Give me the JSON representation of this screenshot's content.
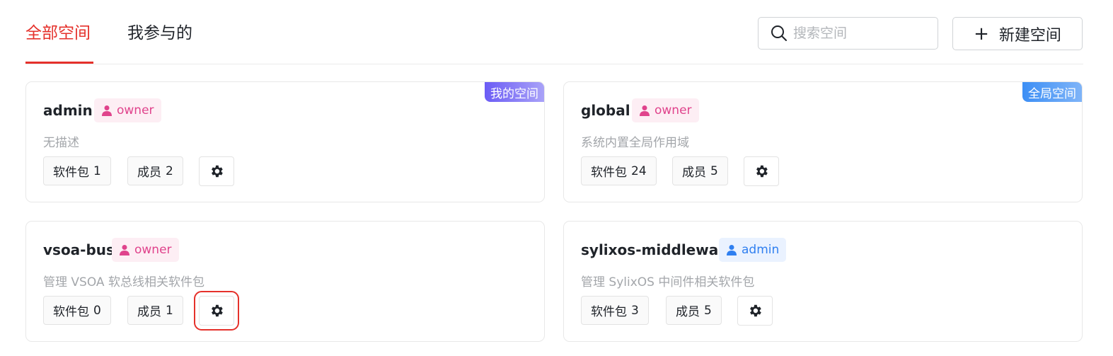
{
  "tabs": [
    {
      "label": "全部空间",
      "active": true
    },
    {
      "label": "我参与的",
      "active": false
    }
  ],
  "search": {
    "placeholder": "搜索空间",
    "value": ""
  },
  "new_button": {
    "label": "新建空间"
  },
  "colors": {
    "accent": "#e5312b",
    "owner": "#e0438c",
    "admin": "#2f7ff0"
  },
  "cards": [
    {
      "name": "admin",
      "role": "owner",
      "badge": "我的空间",
      "description": "无描述",
      "packages_label": "软件包",
      "packages": "1",
      "members_label": "成员",
      "members": "2"
    },
    {
      "name": "global",
      "role": "owner",
      "badge": "全局空间",
      "description": "系统内置全局作用域",
      "packages_label": "软件包",
      "packages": "24",
      "members_label": "成员",
      "members": "5"
    },
    {
      "name": "vsoa-bus",
      "role": "owner",
      "badge": "",
      "description": "管理 VSOA 软总线相关软件包",
      "packages_label": "软件包",
      "packages": "0",
      "members_label": "成员",
      "members": "1"
    },
    {
      "name": "sylixos-middleware",
      "role": "admin",
      "badge": "",
      "description": "管理 SylixOS 中间件相关软件包",
      "packages_label": "软件包",
      "packages": "3",
      "members_label": "成员",
      "members": "5"
    }
  ]
}
